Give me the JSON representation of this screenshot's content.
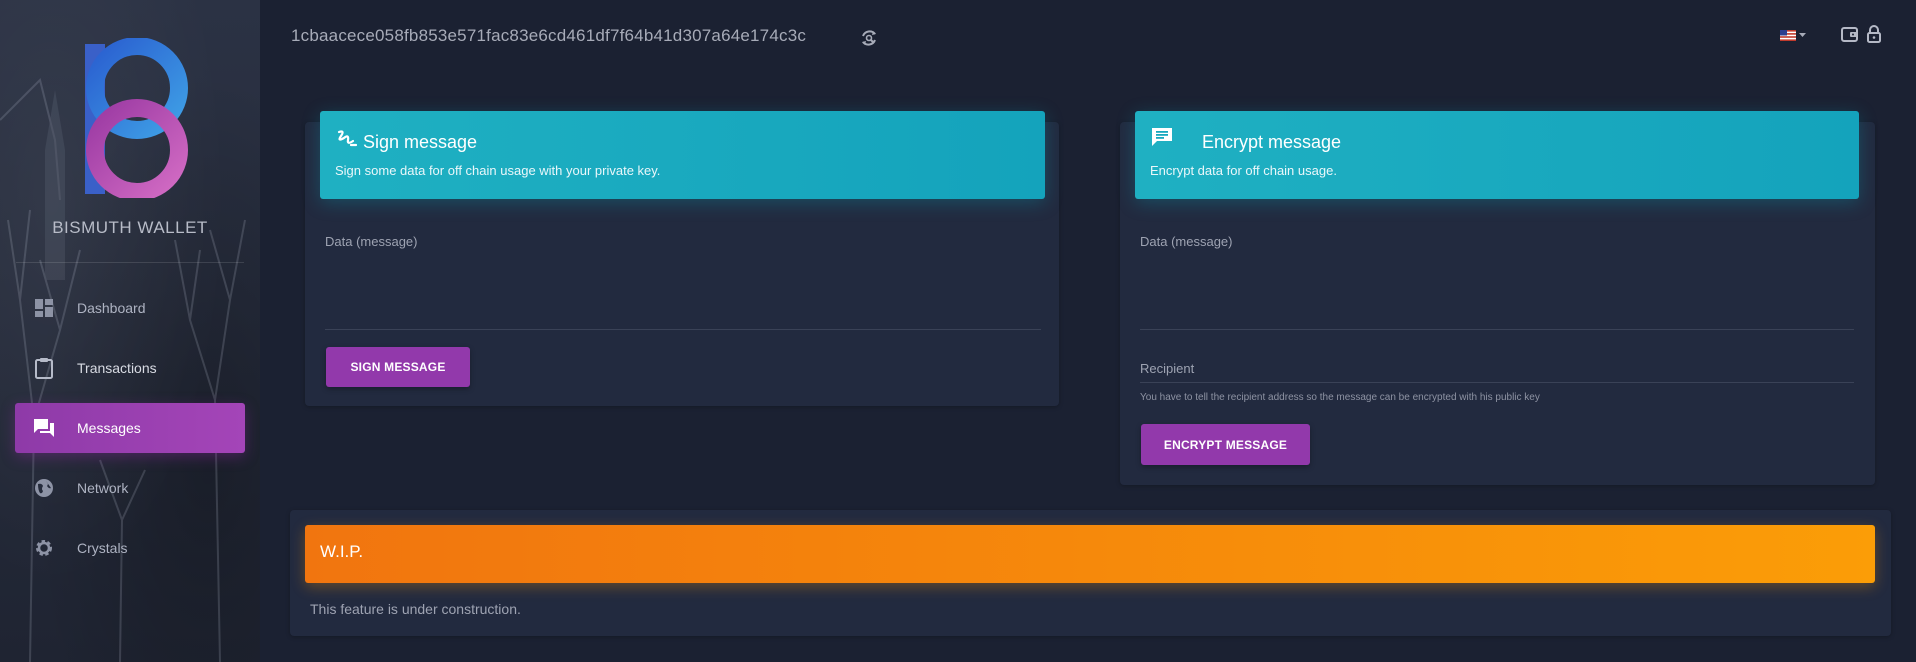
{
  "app": {
    "name": "BISMUTH WALLET"
  },
  "topbar": {
    "address": "1cbaacece058fb853e571fac83e6cd461df7f64b41d307a64e174c3c",
    "refresh_icon": "refresh-icon",
    "language_icon": "us-flag-icon",
    "wallet_icon": "wallet-icon",
    "lock_icon": "lock-icon"
  },
  "sidebar": {
    "items": [
      {
        "label": "Dashboard",
        "icon": "dashboard-icon",
        "active": false
      },
      {
        "label": "Transactions",
        "icon": "clipboard-icon",
        "active": false
      },
      {
        "label": "Messages",
        "icon": "forum-icon",
        "active": true
      },
      {
        "label": "Network",
        "icon": "globe-icon",
        "active": false
      },
      {
        "label": "Crystals",
        "icon": "gear-icon",
        "active": false
      }
    ]
  },
  "sign": {
    "title": "Sign message",
    "subtitle": "Sign some data for off chain usage with your private key.",
    "data_label": "Data (message)",
    "button": "SIGN MESSAGE",
    "icon": "gesture-icon"
  },
  "encrypt": {
    "title": "Encrypt message",
    "subtitle": "Encrypt data for off chain usage.",
    "data_label": "Data (message)",
    "recipient_label": "Recipient",
    "recipient_hint": "You have to tell the recipient address so the message can be encrypted with his public key",
    "button": "ENCRYPT MESSAGE",
    "icon": "message-icon"
  },
  "wip": {
    "title": "W.I.P.",
    "text": "This feature is under construction."
  },
  "colors": {
    "accent": "#9c27b0",
    "header": "#00bcd4",
    "warning": "#ff9800",
    "background": "#1b2132"
  }
}
